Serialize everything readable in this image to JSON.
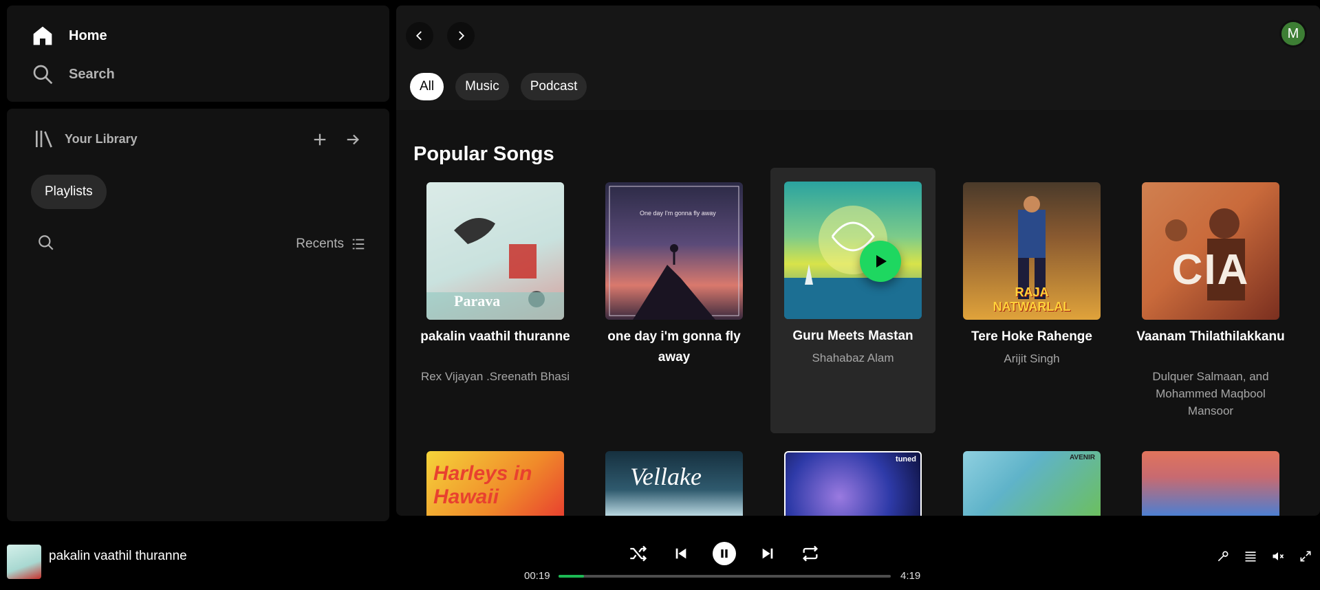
{
  "nav": {
    "home_label": "Home",
    "search_label": "Search"
  },
  "library": {
    "title": "Your Library",
    "chip": "Playlists",
    "sort_label": "Recents"
  },
  "header": {
    "avatar_letter": "M",
    "filters": [
      "All",
      "Music",
      "Podcast"
    ],
    "active_filter": "All"
  },
  "section": {
    "title": "Popular Songs"
  },
  "songs": [
    {
      "title": "pakalin vaathil thuranne",
      "artist": "Rex Vijayan .Sreenath Bhasi",
      "cover_text": "Parava",
      "colors": [
        "#bfe7e1",
        "#c9312c"
      ]
    },
    {
      "title": "one day i'm gonna fly away",
      "artist": "",
      "cover_text": "One day I'm gonna fly away",
      "colors": [
        "#2e2c4a",
        "#d9796d"
      ]
    },
    {
      "title": "Guru Meets Mastan",
      "artist": "Shahabaz Alam",
      "cover_text": "",
      "colors": [
        "#2aa3a0",
        "#d8e34a"
      ]
    },
    {
      "title": "Tere Hoke Rahenge",
      "artist": "Arijit Singh",
      "cover_text": "RAJA NATWARLAL",
      "colors": [
        "#7a4a25",
        "#e0a33b"
      ]
    },
    {
      "title": "Vaanam Thilathilakkanu",
      "artist": "Dulquer Salmaan, and Mohammed Maqbool Mansoor",
      "cover_text": "CIA",
      "colors": [
        "#c96a3b",
        "#7a2f1f"
      ]
    }
  ],
  "row2_covers": [
    {
      "text": "Harleys in Hawaii",
      "colors": [
        "#f5d43a",
        "#e8412f"
      ]
    },
    {
      "text": "Vellake",
      "colors": [
        "#1e3b4d",
        "#b9d7e0"
      ]
    },
    {
      "text": "tuned",
      "colors": [
        "#2e3aa8",
        "#9a7ae0"
      ]
    },
    {
      "text": "AVENIR",
      "colors": [
        "#5fb3c9",
        "#6cbf5f"
      ]
    },
    {
      "text": "",
      "colors": [
        "#4d7fd1",
        "#e0745c"
      ]
    }
  ],
  "player": {
    "now_playing_title": "pakalin vaathil thuranne",
    "current_time": "00:19",
    "total_time": "4:19",
    "progress_fraction": 0.076,
    "accent": "#1db954"
  }
}
